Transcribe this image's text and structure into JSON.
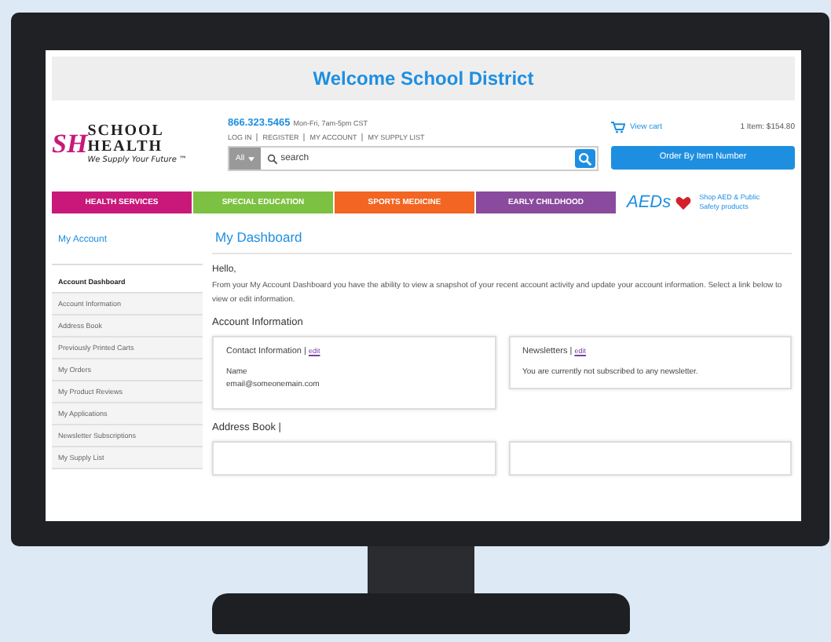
{
  "banner": {
    "title": "Welcome School District"
  },
  "logo": {
    "mark": "SH",
    "line1": "SCHOOL",
    "line2": "HEALTH",
    "tagline": "We Supply Your Future ™"
  },
  "contact": {
    "phone": "866.323.5465",
    "hours": "Mon-Fri, 7am-5pm CST"
  },
  "top_links": [
    "LOG IN",
    "REGISTER",
    "MY ACCOUNT",
    "MY SUPPLY LIST"
  ],
  "cart": {
    "label": "View cart",
    "summary": "1 Item: $154.80"
  },
  "search": {
    "scope": "All",
    "placeholder": "search"
  },
  "order_button": "Order By Item Number",
  "categories": [
    {
      "label": "HEALTH SERVICES",
      "color": "#c8197a"
    },
    {
      "label": "SPECIAL EDUCATION",
      "color": "#7dc142"
    },
    {
      "label": "SPORTS MEDICINE",
      "color": "#f26522"
    },
    {
      "label": "EARLY CHILDHOOD",
      "color": "#8a4a9e"
    }
  ],
  "aed": {
    "label": "AEDs",
    "link": "Shop AED & Public Safety products"
  },
  "sidebar": {
    "title": "My Account",
    "items": [
      {
        "label": "Account Dashboard",
        "selected": true
      },
      {
        "label": "Account Information",
        "selected": false
      },
      {
        "label": "Address Book",
        "selected": false
      },
      {
        "label": "Previously Printed Carts",
        "selected": false
      },
      {
        "label": "My Orders",
        "selected": false
      },
      {
        "label": "My Product Reviews",
        "selected": false
      },
      {
        "label": "My Applications",
        "selected": false
      },
      {
        "label": "Newsletter Subscriptions",
        "selected": false
      },
      {
        "label": "My Supply List",
        "selected": false
      }
    ]
  },
  "dashboard": {
    "title": "My Dashboard",
    "greeting": "Hello,",
    "intro": "From your My Account Dashboard you have the ability to view a snapshot of your recent account activity and update your account information. Select a link below to view or edit information.",
    "section_title": "Account Information",
    "contact_box": {
      "title": "Contact Information |",
      "edit": "edit",
      "lines": [
        "Name",
        "email@someonemain.com"
      ]
    },
    "newsletter_box": {
      "title": "Newsletters |",
      "edit": "edit",
      "text": "You are currently not subscribed to any newsletter."
    },
    "address_title": "Address Book |"
  }
}
